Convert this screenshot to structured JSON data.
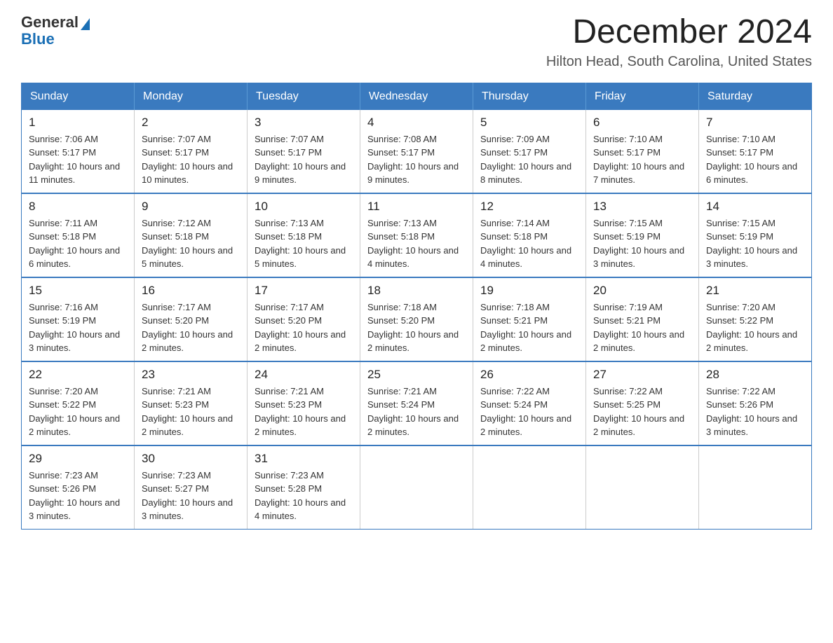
{
  "logo": {
    "text_general": "General",
    "text_blue": "Blue"
  },
  "header": {
    "title": "December 2024",
    "subtitle": "Hilton Head, South Carolina, United States"
  },
  "weekdays": [
    "Sunday",
    "Monday",
    "Tuesday",
    "Wednesday",
    "Thursday",
    "Friday",
    "Saturday"
  ],
  "weeks": [
    [
      {
        "day": "1",
        "sunrise": "7:06 AM",
        "sunset": "5:17 PM",
        "daylight": "10 hours and 11 minutes."
      },
      {
        "day": "2",
        "sunrise": "7:07 AM",
        "sunset": "5:17 PM",
        "daylight": "10 hours and 10 minutes."
      },
      {
        "day": "3",
        "sunrise": "7:07 AM",
        "sunset": "5:17 PM",
        "daylight": "10 hours and 9 minutes."
      },
      {
        "day": "4",
        "sunrise": "7:08 AM",
        "sunset": "5:17 PM",
        "daylight": "10 hours and 9 minutes."
      },
      {
        "day": "5",
        "sunrise": "7:09 AM",
        "sunset": "5:17 PM",
        "daylight": "10 hours and 8 minutes."
      },
      {
        "day": "6",
        "sunrise": "7:10 AM",
        "sunset": "5:17 PM",
        "daylight": "10 hours and 7 minutes."
      },
      {
        "day": "7",
        "sunrise": "7:10 AM",
        "sunset": "5:17 PM",
        "daylight": "10 hours and 6 minutes."
      }
    ],
    [
      {
        "day": "8",
        "sunrise": "7:11 AM",
        "sunset": "5:18 PM",
        "daylight": "10 hours and 6 minutes."
      },
      {
        "day": "9",
        "sunrise": "7:12 AM",
        "sunset": "5:18 PM",
        "daylight": "10 hours and 5 minutes."
      },
      {
        "day": "10",
        "sunrise": "7:13 AM",
        "sunset": "5:18 PM",
        "daylight": "10 hours and 5 minutes."
      },
      {
        "day": "11",
        "sunrise": "7:13 AM",
        "sunset": "5:18 PM",
        "daylight": "10 hours and 4 minutes."
      },
      {
        "day": "12",
        "sunrise": "7:14 AM",
        "sunset": "5:18 PM",
        "daylight": "10 hours and 4 minutes."
      },
      {
        "day": "13",
        "sunrise": "7:15 AM",
        "sunset": "5:19 PM",
        "daylight": "10 hours and 3 minutes."
      },
      {
        "day": "14",
        "sunrise": "7:15 AM",
        "sunset": "5:19 PM",
        "daylight": "10 hours and 3 minutes."
      }
    ],
    [
      {
        "day": "15",
        "sunrise": "7:16 AM",
        "sunset": "5:19 PM",
        "daylight": "10 hours and 3 minutes."
      },
      {
        "day": "16",
        "sunrise": "7:17 AM",
        "sunset": "5:20 PM",
        "daylight": "10 hours and 2 minutes."
      },
      {
        "day": "17",
        "sunrise": "7:17 AM",
        "sunset": "5:20 PM",
        "daylight": "10 hours and 2 minutes."
      },
      {
        "day": "18",
        "sunrise": "7:18 AM",
        "sunset": "5:20 PM",
        "daylight": "10 hours and 2 minutes."
      },
      {
        "day": "19",
        "sunrise": "7:18 AM",
        "sunset": "5:21 PM",
        "daylight": "10 hours and 2 minutes."
      },
      {
        "day": "20",
        "sunrise": "7:19 AM",
        "sunset": "5:21 PM",
        "daylight": "10 hours and 2 minutes."
      },
      {
        "day": "21",
        "sunrise": "7:20 AM",
        "sunset": "5:22 PM",
        "daylight": "10 hours and 2 minutes."
      }
    ],
    [
      {
        "day": "22",
        "sunrise": "7:20 AM",
        "sunset": "5:22 PM",
        "daylight": "10 hours and 2 minutes."
      },
      {
        "day": "23",
        "sunrise": "7:21 AM",
        "sunset": "5:23 PM",
        "daylight": "10 hours and 2 minutes."
      },
      {
        "day": "24",
        "sunrise": "7:21 AM",
        "sunset": "5:23 PM",
        "daylight": "10 hours and 2 minutes."
      },
      {
        "day": "25",
        "sunrise": "7:21 AM",
        "sunset": "5:24 PM",
        "daylight": "10 hours and 2 minutes."
      },
      {
        "day": "26",
        "sunrise": "7:22 AM",
        "sunset": "5:24 PM",
        "daylight": "10 hours and 2 minutes."
      },
      {
        "day": "27",
        "sunrise": "7:22 AM",
        "sunset": "5:25 PM",
        "daylight": "10 hours and 2 minutes."
      },
      {
        "day": "28",
        "sunrise": "7:22 AM",
        "sunset": "5:26 PM",
        "daylight": "10 hours and 3 minutes."
      }
    ],
    [
      {
        "day": "29",
        "sunrise": "7:23 AM",
        "sunset": "5:26 PM",
        "daylight": "10 hours and 3 minutes."
      },
      {
        "day": "30",
        "sunrise": "7:23 AM",
        "sunset": "5:27 PM",
        "daylight": "10 hours and 3 minutes."
      },
      {
        "day": "31",
        "sunrise": "7:23 AM",
        "sunset": "5:28 PM",
        "daylight": "10 hours and 4 minutes."
      },
      null,
      null,
      null,
      null
    ]
  ]
}
